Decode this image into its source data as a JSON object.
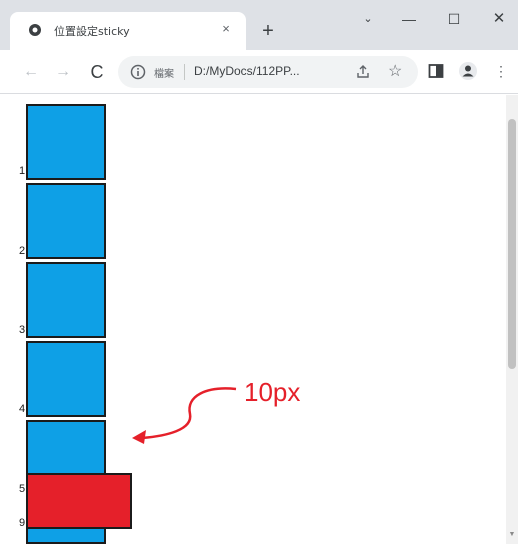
{
  "tab": {
    "title": "位置設定sticky",
    "close": "×"
  },
  "window": {
    "new_tab": "+",
    "menu": "⌄",
    "minimize": "—",
    "maximize": "☐",
    "close": "✕"
  },
  "toolbar": {
    "back": "←",
    "forward": "→",
    "reload": "C",
    "scheme_label": "檔案",
    "url": "D:/MyDocs/112PP...",
    "star": "☆",
    "menu": "⋮"
  },
  "page": {
    "boxes": [
      {
        "label": "1"
      },
      {
        "label": "2"
      },
      {
        "label": "3"
      },
      {
        "label": "4"
      },
      {
        "label": "5"
      }
    ],
    "overlay_number": "9",
    "annotation": "10px"
  },
  "colors": {
    "box_fill": "#0ea0e6",
    "sticky_fill": "#e5202a",
    "annotation": "#e5202a"
  }
}
